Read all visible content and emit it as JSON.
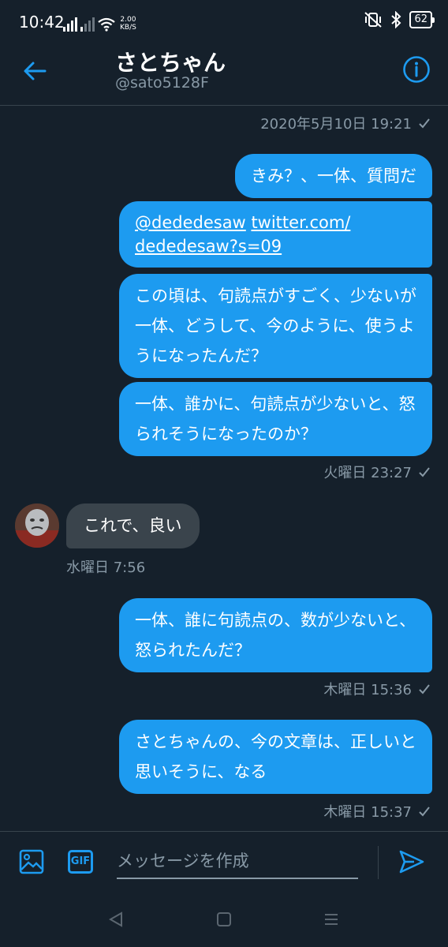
{
  "status_bar": {
    "time": "10:42",
    "net_speed_value": "2.00",
    "net_speed_unit": "KB/S",
    "battery": "62"
  },
  "header": {
    "name": "さとちゃん",
    "handle": "@sato5128F",
    "accent_color": "#1d9bf0"
  },
  "thread": {
    "top_timestamp": "2020年5月10日 19:21",
    "group1": {
      "messages": [
        "きみ？、一体、質問だ",
        {
          "mention": "@dededesaw",
          "link_line1": "twitter.com/",
          "link_line2": "dededesaw?s=09"
        },
        "この頃は、句読点がすごく、少ないが一体、どうして、今のように、使うようになったんだ？",
        "一体、誰かに、句読点が少ないと、怒られそうになったのか？"
      ],
      "timestamp": "火曜日 23:27"
    },
    "incoming": {
      "text": "これで、良い",
      "timestamp": "水曜日 7:56"
    },
    "group2": {
      "text": "一体、誰に句読点の、数が少ないと、怒られたんだ？",
      "timestamp": "木曜日 15:36"
    },
    "group3": {
      "text": "さとちゃんの、今の文章は、正しいと思いそうに、なる",
      "timestamp": "木曜日 15:37"
    }
  },
  "composer": {
    "placeholder": "メッセージを作成",
    "gif_label": "GIF"
  }
}
